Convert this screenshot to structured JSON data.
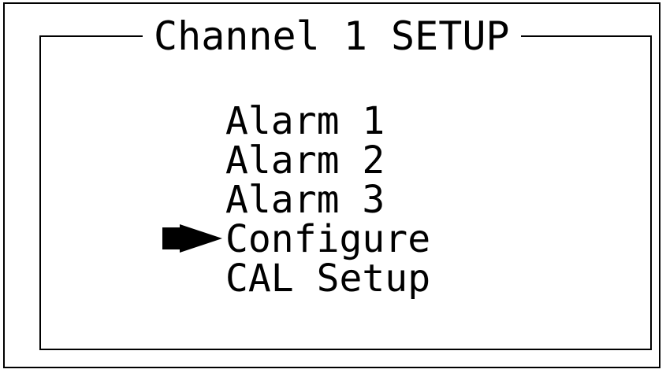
{
  "screen": {
    "title": "Channel 1 SETUP",
    "menu_items": [
      {
        "label": "Alarm 1"
      },
      {
        "label": "Alarm 2"
      },
      {
        "label": "Alarm 3"
      },
      {
        "label": "Configure",
        "selected": true
      },
      {
        "label": "CAL Setup"
      }
    ],
    "selector_icon": "right-arrow-icon",
    "colors": {
      "foreground": "#000000",
      "background": "#ffffff"
    }
  }
}
